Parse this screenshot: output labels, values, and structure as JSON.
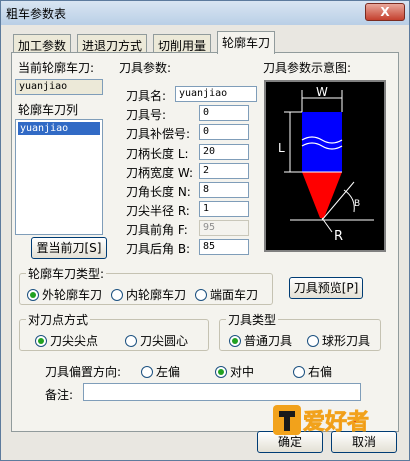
{
  "window": {
    "title": "粗车参数表",
    "close_glyph": "X"
  },
  "tabs": [
    "加工参数",
    "进退刀方式",
    "切削用量",
    "轮廓车刀"
  ],
  "left": {
    "current_label": "当前轮廓车刀:",
    "current_value": "yuanjiao",
    "list_label": "轮廓车刀列",
    "list_items": [
      "yuanjiao"
    ],
    "set_current_button": "置当前刀[S]"
  },
  "params": {
    "section_label": "刀具参数:",
    "fields": [
      {
        "label": "刀具名:",
        "value": "yuanjiao",
        "disabled": false
      },
      {
        "label": "刀具号:",
        "value": "0",
        "disabled": false
      },
      {
        "label": "刀具补偿号:",
        "value": "0",
        "disabled": false
      },
      {
        "label": "刀柄长度 L:",
        "value": "20",
        "disabled": false
      },
      {
        "label": "刀柄宽度 W:",
        "value": "2",
        "disabled": false
      },
      {
        "label": "刀角长度 N:",
        "value": "8",
        "disabled": false
      },
      {
        "label": "刀尖半径 R:",
        "value": "1",
        "disabled": false
      },
      {
        "label": "刀具前角 F:",
        "value": "95",
        "disabled": true
      },
      {
        "label": "刀具后角 B:",
        "value": "85",
        "disabled": false
      }
    ]
  },
  "diagram": {
    "label": "刀具参数示意图:",
    "labels": {
      "w": "W",
      "l": "L",
      "r": "R",
      "b": "B"
    }
  },
  "tool_type_group": {
    "title": "轮廓车刀类型:",
    "options": [
      "外轮廓车刀",
      "内轮廓车刀",
      "端面车刀"
    ],
    "selected": 0
  },
  "preview_button": "刀具预览[P]",
  "tip_group": {
    "title": "对刀点方式",
    "options": [
      "刀尖尖点",
      "刀尖圆心"
    ],
    "selected": 0
  },
  "cutter_group": {
    "title": "刀具类型",
    "options": [
      "普通刀具",
      "球形刀具"
    ],
    "selected": 0
  },
  "offset": {
    "label": "刀具偏置方向:",
    "options": [
      "左偏",
      "对中",
      "右偏"
    ],
    "selected": 1
  },
  "note": {
    "label": "备注:",
    "value": ""
  },
  "footer": {
    "ok": "确定",
    "cancel": "取消"
  },
  "watermark": "爱好者",
  "colors": {
    "tool_body": "#0000ff",
    "tool_tip": "#ff0000",
    "diagram_bg": "#000000",
    "radio_dot": "#21a121"
  }
}
